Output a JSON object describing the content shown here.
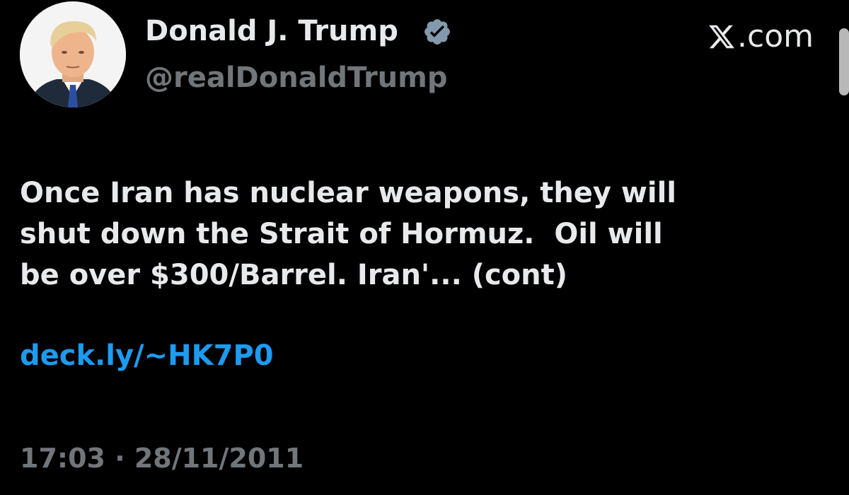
{
  "colors": {
    "background": "#000000",
    "text": "#e7e9ea",
    "secondary_text": "#71767b",
    "link": "#1d9bf0",
    "verified_badge": "#829aab"
  },
  "author": {
    "display_name": "Donald J. Trump",
    "handle": "@realDonaldTrump",
    "verified_icon": "verified-badge-icon",
    "avatar_icon": "profile-photo"
  },
  "site": {
    "label": ".com",
    "logo_icon": "x-logo-icon"
  },
  "tweet": {
    "text": "Once Iran has nuclear weapons, they will\nshut down the Strait of Hormuz.  Oil will\nbe over $300/Barrel. Iran'... (cont)",
    "link": "deck.ly/~HK7P0",
    "timestamp": "17:03 · 28/11/2011"
  }
}
